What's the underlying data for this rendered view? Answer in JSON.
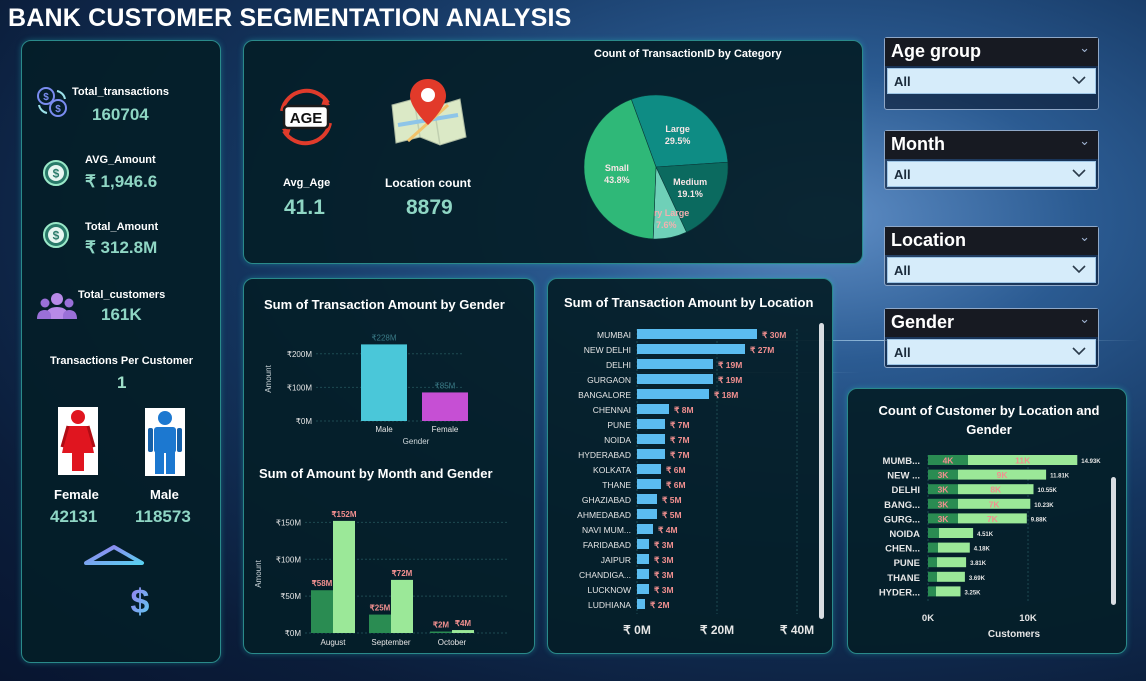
{
  "title": "BANK CUSTOMER SEGMENTATION ANALYSIS",
  "kpis": {
    "total_transactions_label": "Total_transactions",
    "total_transactions_value": "160704",
    "avg_amount_label": "AVG_Amount",
    "avg_amount_value": "₹ 1,946.6",
    "total_amount_label": "Total_Amount",
    "total_amount_value": "₹ 312.8M",
    "total_customers_label": "Total_customers",
    "total_customers_value": "161K",
    "tpc_label": "Transactions Per Customer",
    "tpc_value": "1",
    "female_label": "Female",
    "female_value": "42131",
    "male_label": "Male",
    "male_value": "118573",
    "avg_age_label": "Avg_Age",
    "avg_age_value": "41.1",
    "location_count_label": "Location count",
    "location_count_value": "8879",
    "age_badge_text": "AGE"
  },
  "slicers": [
    {
      "title": "Age group",
      "value": "All"
    },
    {
      "title": "Month",
      "value": "All"
    },
    {
      "title": "Location",
      "value": "All"
    },
    {
      "title": "Gender",
      "value": "All"
    }
  ],
  "colors": {
    "pie_large": "#0e8c84",
    "pie_medium": "#0b6a5f",
    "pie_small": "#2fb878",
    "pie_very_large": "#6fd0b8",
    "male_bar": "#4ac7d9",
    "female_bar": "#c64fd4",
    "month_male": "#9be898",
    "month_female": "#2a8c52",
    "location_bar": "#5bbcf0",
    "label_salmon": "#f08f8f",
    "customer_male": "#9be898",
    "customer_female": "#2a8c52"
  },
  "chart_data": [
    {
      "id": "pie",
      "type": "pie",
      "title": "Count of TransactionID by Category",
      "slices": [
        {
          "label": "Large",
          "value": 29.5,
          "display": "29.5%"
        },
        {
          "label": "Medium",
          "value": 19.1,
          "display": "19.1%"
        },
        {
          "label": "Very Large",
          "value": 7.6,
          "display": "7.6%"
        },
        {
          "label": "Small",
          "value": 43.8,
          "display": "43.8%"
        }
      ]
    },
    {
      "id": "gender_amount",
      "type": "bar",
      "title": "Sum of Transaction Amount by Gender",
      "xlabel": "Gender",
      "ylabel": "Amount",
      "categories": [
        "Male",
        "Female"
      ],
      "values": [
        228,
        85
      ],
      "data_labels": [
        "₹228M",
        "₹85M"
      ],
      "ylim": [
        0,
        250
      ],
      "yticks": [
        0,
        100,
        200
      ],
      "ytick_labels": [
        "₹0M",
        "₹100M",
        "₹200M"
      ]
    },
    {
      "id": "month_gender",
      "type": "bar",
      "title": "Sum of Amount by Month and Gender",
      "ylabel": "Amount",
      "categories": [
        "August",
        "September",
        "October"
      ],
      "series": [
        {
          "values": [
            58,
            25,
            2
          ],
          "data_labels": [
            "₹58M",
            "₹25M",
            "₹2M"
          ]
        },
        {
          "values": [
            152,
            72,
            4
          ],
          "data_labels": [
            "₹152M",
            "₹72M",
            "₹4M"
          ]
        }
      ],
      "ylim": [
        0,
        160
      ],
      "yticks": [
        0,
        50,
        100,
        150
      ],
      "ytick_labels": [
        "₹0M",
        "₹50M",
        "₹100M",
        "₹150M"
      ]
    },
    {
      "id": "location_amount",
      "type": "bar",
      "title": "Sum of Transaction Amount by Location",
      "categories": [
        "MUMBAI",
        "NEW DELHI",
        "DELHI",
        "GURGAON",
        "BANGALORE",
        "CHENNAI",
        "PUNE",
        "NOIDA",
        "HYDERABAD",
        "KOLKATA",
        "THANE",
        "GHAZIABAD",
        "AHMEDABAD",
        "NAVI MUM...",
        "FARIDABAD",
        "JAIPUR",
        "CHANDIGA...",
        "LUCKNOW",
        "LUDHIANA"
      ],
      "values": [
        30,
        27,
        19,
        19,
        18,
        8,
        7,
        7,
        7,
        6,
        6,
        5,
        5,
        4,
        3,
        3,
        3,
        3,
        2
      ],
      "data_labels": [
        "₹ 30M",
        "₹ 27M",
        "₹ 19M",
        "₹ 19M",
        "₹ 18M",
        "₹ 8M",
        "₹ 7M",
        "₹ 7M",
        "₹ 7M",
        "₹ 6M",
        "₹ 6M",
        "₹ 5M",
        "₹ 5M",
        "₹ 4M",
        "₹ 3M",
        "₹ 3M",
        "₹ 3M",
        "₹ 3M",
        "₹ 2M"
      ],
      "xlim": [
        0,
        40
      ],
      "xticks": [
        0,
        20,
        40
      ],
      "xtick_labels": [
        "₹ 0M",
        "₹ 20M",
        "₹ 40M"
      ]
    },
    {
      "id": "customer_location_gender",
      "type": "bar",
      "title": "Count of Customer by Location and Gender",
      "xlabel": "Customers",
      "categories": [
        "MUMB...",
        "NEW ...",
        "DELHI",
        "BANG...",
        "GURG...",
        "NOIDA",
        "CHEN...",
        "PUNE",
        "THANE",
        "HYDER..."
      ],
      "series": [
        {
          "values": [
            4.0,
            3.0,
            3.0,
            3.0,
            3.0,
            1.1,
            1.0,
            0.9,
            0.9,
            0.8
          ],
          "data_labels": [
            "4K",
            "3K",
            "3K",
            "3K",
            "3K",
            "",
            "",
            "",
            "",
            ""
          ]
        },
        {
          "values": [
            10.93,
            8.81,
            7.55,
            7.23,
            6.88,
            3.41,
            3.18,
            2.91,
            2.79,
            2.45
          ],
          "data_labels": [
            "11K",
            "9K",
            "8K",
            "7K",
            "7K",
            "",
            "",
            "",
            "",
            ""
          ]
        }
      ],
      "totals": [
        "14.93K",
        "11.81K",
        "10.55K",
        "10.23K",
        "9.88K",
        "4.51K",
        "4.18K",
        "3.81K",
        "3.69K",
        "3.25K"
      ],
      "xlim": [
        0,
        15
      ],
      "xticks": [
        0,
        10
      ],
      "xtick_labels": [
        "0K",
        "10K"
      ]
    }
  ]
}
